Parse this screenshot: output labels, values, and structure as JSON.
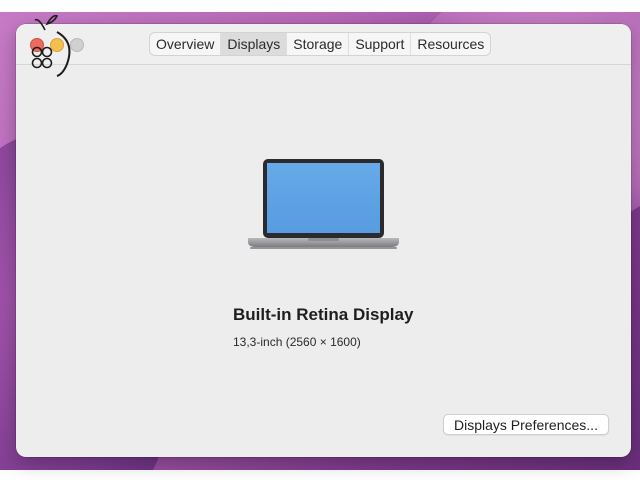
{
  "window": {
    "tabs": [
      {
        "label": "Overview",
        "selected": false
      },
      {
        "label": "Displays",
        "selected": true
      },
      {
        "label": "Storage",
        "selected": false
      },
      {
        "label": "Support",
        "selected": false
      },
      {
        "label": "Resources",
        "selected": false
      }
    ]
  },
  "display": {
    "name": "Built-in Retina Display",
    "size": "13,3-inch (2560 × 1600)",
    "icon": "macbook-laptop-icon"
  },
  "buttons": {
    "preferences_label": "Displays Preferences..."
  },
  "colors": {
    "close": "#ed6a5e",
    "minimize": "#f5bf4f",
    "zoom_inactive": "#d0d0d0",
    "screen_blue": "#5ea3e6"
  }
}
